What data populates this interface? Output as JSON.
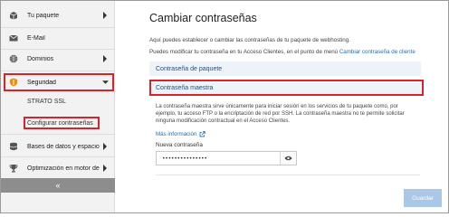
{
  "sidebar": {
    "items": [
      {
        "label": "Tu paquete",
        "icon": "package-icon"
      },
      {
        "label": "E-Mail",
        "icon": "mail-icon"
      },
      {
        "label": "Dominios",
        "icon": "globe-icon"
      },
      {
        "label": "Seguridad",
        "icon": "shield-icon"
      },
      {
        "label": "Bases de datos y espacio web",
        "icon": "database-icon"
      },
      {
        "label": "Optimización en motor de búsqueda",
        "icon": "trophy-icon"
      }
    ],
    "sub_items": [
      {
        "label": "STRATO SSL"
      },
      {
        "label": "Configurar contraseñas"
      }
    ],
    "collapse_label": "«"
  },
  "main": {
    "title": "Cambiar contraseñas",
    "intro_line1": "Aquí puedes establecer o cambiar las contraseñas de tu paquete de webhosting.",
    "intro_line2": "Puedes modificar tu contraseña en tu Acceso Clientes, en el punto de menú",
    "intro_link": "Cambiar contraseña de cliente",
    "section_package": "Contraseña de paquete",
    "section_master": "Contraseña maestra",
    "description": "La contraseña maestra sirve únicamente para iniciar sesión en los servicios de tu paquete como, por ejemplo, tu acceso FTP o la encriptación de red por SSH. La contraseña maestra no te permite solicitar ninguna modificación contractual en el Acceso Clientes.",
    "more_info": "Más información",
    "field_label": "Nueva contraseña",
    "password_value": "•••••••••••••••",
    "save_label": "Guardar"
  },
  "colors": {
    "accent": "#1d6fb8",
    "highlight": "#d9222a",
    "section_bg": "#eef3f9",
    "button_disabled": "#a9c7e6",
    "security_icon": "#f08c00"
  }
}
